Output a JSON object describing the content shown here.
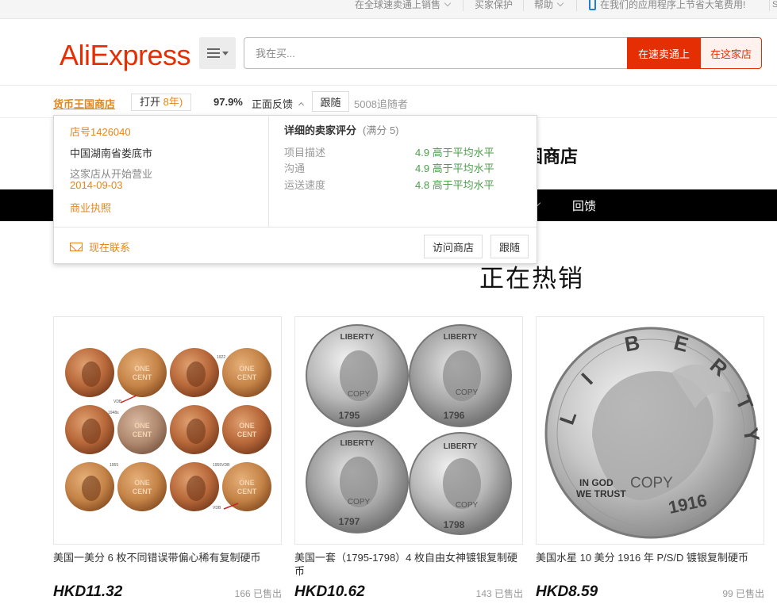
{
  "topbar": {
    "sell_label": "在全球速卖通上销售",
    "buyer_protection": "买家保护",
    "help": "帮助",
    "app_promo": "在我们的应用程序上节省大笔费用!",
    "corner": "S"
  },
  "header": {
    "logo": "AliExpress",
    "search_placeholder": "我在买...",
    "search_all_button": "在速卖通上",
    "search_store_button": "在这家店"
  },
  "store_bar": {
    "store_name": "货币王国商店",
    "open_label": "打开",
    "open_years": "8年)",
    "feedback_percent": "97.9%",
    "feedback_label": "正面反馈",
    "follow_button": "跟随",
    "followers": "5008追随者"
  },
  "store_popup": {
    "store_number": "店号1426040",
    "location": "中国湖南省娄底市",
    "open_since_label": "这家店从开始营业",
    "open_since_date": "2014-09-03",
    "business_license": "商业执照",
    "rating_title": "详细的卖家评分",
    "rating_full": "(满分 5)",
    "ratings": [
      {
        "label": "项目描述",
        "value": "4.9 高于平均水平"
      },
      {
        "label": "沟通",
        "value": "4.9 高于平均水平"
      },
      {
        "label": "运送速度",
        "value": "4.8 高于平均水平"
      }
    ],
    "contact_now": "现在联系",
    "visit_store_button": "访问商店",
    "follow_button": "跟随"
  },
  "page": {
    "store_title_partial": "国商店",
    "nav_feedback": "回馈",
    "hot_selling_title": "正在热销"
  },
  "products": [
    {
      "title": "美国一美分 6 枚不同错误带偏心稀有复制硬币",
      "price": "HKD11.32",
      "sold": "166 已售出"
    },
    {
      "title": "美国一套（1795-1798）4 枚自由女神镀银复制硬币",
      "price": "HKD10.62",
      "sold": "143 已售出"
    },
    {
      "title": "美国水星 10 美分 1916 年 P/S/D 镀银复制硬币",
      "price": "HKD8.59",
      "sold": "99 已售出"
    }
  ],
  "coin_text": {
    "one": "ONE",
    "cent": "CENT",
    "copy": "COPY",
    "liberty": "LIBERTY",
    "in_god": "IN GOD",
    "we_trust": "WE TRUST",
    "year_1916": "1916",
    "years_set": [
      "1795",
      "1796",
      "1797",
      "1798"
    ],
    "cent_years": [
      "1922",
      "1948s",
      "1955",
      "1955VDB"
    ],
    "vdb": "VDB"
  },
  "colors": {
    "brand": "#e62e04",
    "store_orange": "#e5861a",
    "rating_green": "#4b9e4b"
  }
}
